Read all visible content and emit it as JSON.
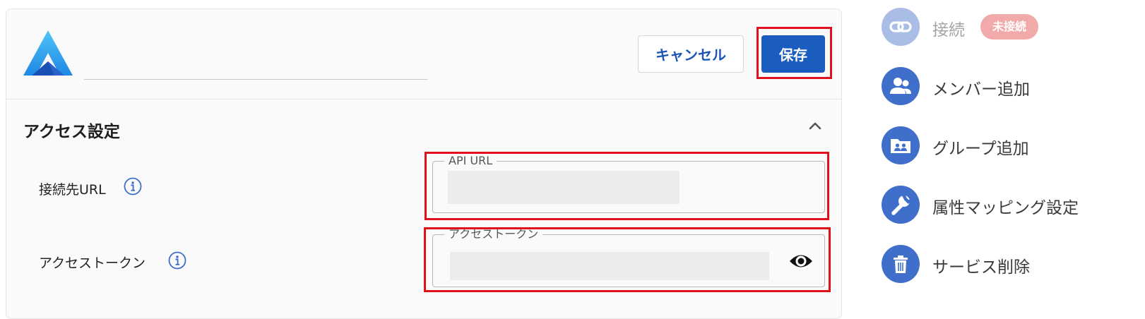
{
  "header": {
    "name_value": "",
    "cancel_label": "キャンセル",
    "save_label": "保存"
  },
  "section": {
    "title": "アクセス設定",
    "collapse_icon": "chevron-up-icon"
  },
  "fields": {
    "api_url": {
      "row_label": "接続先URL",
      "legend": "API URL",
      "value": ""
    },
    "access_token": {
      "row_label": "アクセストークン",
      "legend": "アクセストークン",
      "value": "",
      "toggle_icon": "eye-icon"
    }
  },
  "sidebar": {
    "connection": {
      "label": "接続",
      "badge": "未接続",
      "icon": "link-icon"
    },
    "items": [
      {
        "label": "メンバー追加",
        "icon": "people-icon"
      },
      {
        "label": "グループ追加",
        "icon": "group-folder-icon"
      },
      {
        "label": "属性マッピング設定",
        "icon": "wrench-icon"
      },
      {
        "label": "サービス削除",
        "icon": "trash-icon"
      }
    ]
  },
  "colors": {
    "accent": "#1b5cbf",
    "sidebar_icon_bg": "#3f6fca",
    "sidebar_icon_bg_disabled": "#a9bde6",
    "badge_bg": "#f2a9a9",
    "highlight": "#e0101c"
  }
}
